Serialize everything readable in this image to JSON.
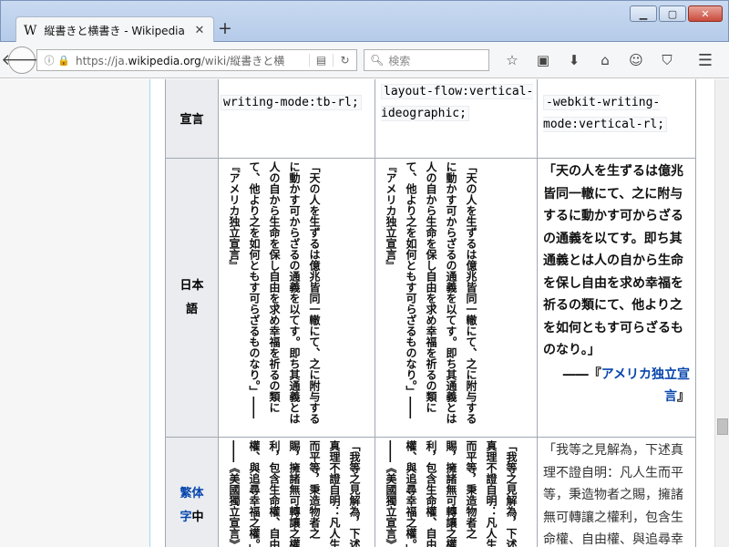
{
  "browser": {
    "tab_title": "縦書きと横書き - Wikipedia",
    "tab_icon": "W",
    "url_prefix": "https://ja.",
    "url_domain": "wikipedia.org",
    "url_path": "/wiki/縦書きと横",
    "search_placeholder": "検索"
  },
  "table": {
    "row_header_1": "宣言",
    "col1_code": "writing-mode:tb-rl;",
    "col2_code": "layout-flow:vertical-ideographic;",
    "col3_code": "-webkit-writing-mode:vertical-rl;",
    "row_header_2": "日本語",
    "jp_vertical_text": "「天の人を生ずるは億兆皆同一轍にて、之に附与するに動かす可からざるの通義を以てす。即ち其通義とは人の自から生命を保し自由を求め幸福を祈るの類にて、他より之を如何ともす可らざるものなり。」――『アメリカ独立宣言』",
    "jp_horizontal_text": "「天の人を生ずるは億兆皆同一轍にて、之に附与するに動かす可からざるの通義を以てす。即ち其通義とは人の自から生命を保し自由を求め幸福を祈るの類にて、他より之を如何ともす可らざるものなり。」",
    "jp_attribution_dash": "――『",
    "jp_attribution_link": "アメリカ独立宣言",
    "jp_attribution_close": "』",
    "row_header_3_link": "繁体字",
    "row_header_3_suffix": "中",
    "tc_vertical_text": "「我等之見解為，下述真理不證自明：凡人生而平等，秉造物者之賜，擁諸無可轉讓之權利，包含生命權、自由權、與追尋幸福之權。」――《美國獨立宣言》",
    "tc_horizontal_text": "「我等之見解為，下述真理不證自明：凡人生而平等，秉造物者之賜，擁諸無可轉讓之權利，包含生命權、自由權、與追尋幸福之權。」"
  }
}
